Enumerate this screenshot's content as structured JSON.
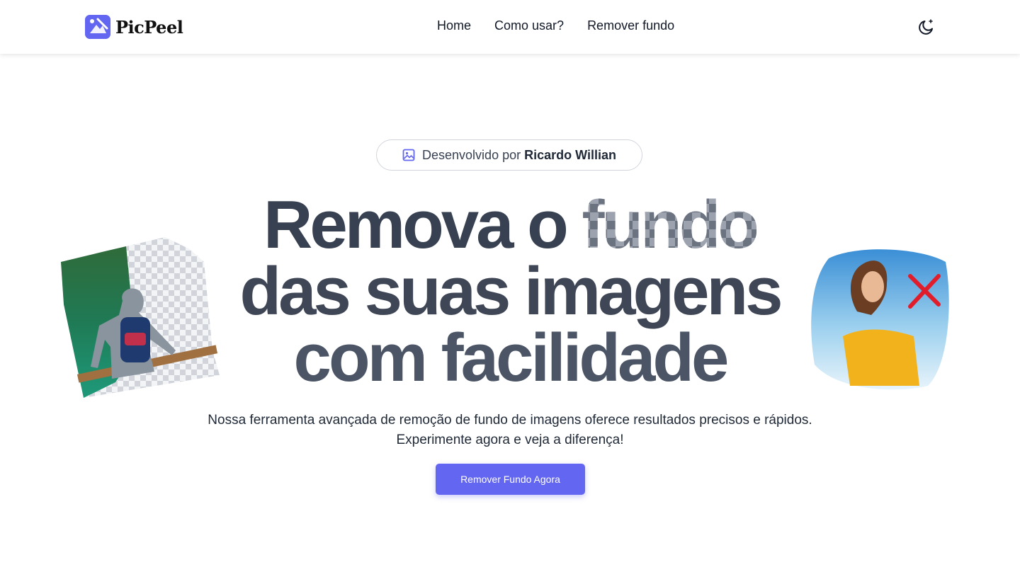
{
  "brand": {
    "name": "PicPeel",
    "accent": "#6366f1"
  },
  "nav": {
    "items": [
      "Home",
      "Como usar?",
      "Remover fundo"
    ]
  },
  "theme_toggle": {
    "icon": "moon-icon"
  },
  "badge": {
    "prefix": "Desenvolvido por",
    "author": "Ricardo Willian",
    "icon": "image-icon"
  },
  "hero": {
    "line1_a": "Remova o",
    "line1_b": "fundo",
    "line2": "das suas imagens",
    "line3": "com facilidade",
    "sub1": "Nossa ferramenta avançada de remoção de fundo de imagens oferece resultados precisos e rápidos.",
    "sub2": "Experimente agora e veja a diferença!",
    "cta": "Remover Fundo Agora"
  }
}
